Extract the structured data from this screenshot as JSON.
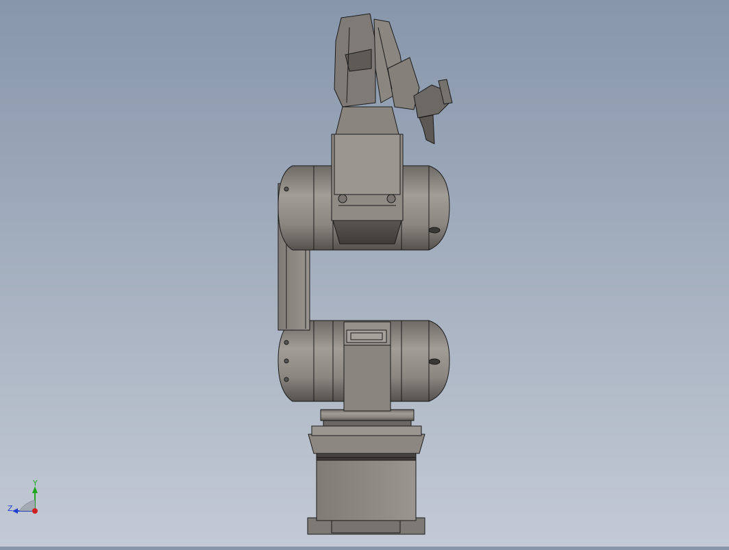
{
  "viewport": {
    "background_top": "#8796ab",
    "background_bottom": "#c3cad5",
    "model_fill": "#8f8a84",
    "model_dark": "#4a4744",
    "edge_color": "#1a1a1a"
  },
  "triad": {
    "y_label": "Y",
    "z_label": "Z",
    "y_color": "#1fa81f",
    "z_color": "#1f3fd0",
    "origin_color": "#d01f1f"
  }
}
